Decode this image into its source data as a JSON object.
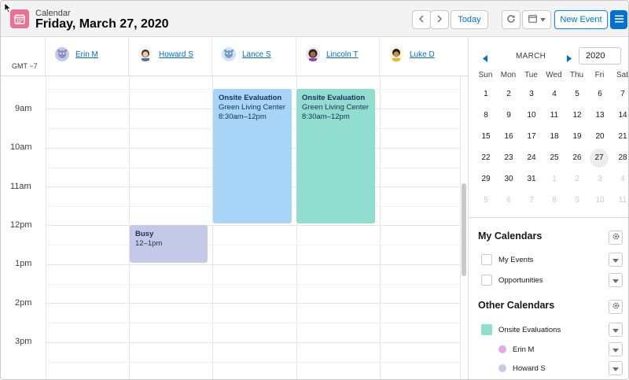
{
  "header": {
    "kicker": "Calendar",
    "title": "Friday, March 27, 2020",
    "today_label": "Today",
    "new_event_label": "New Event"
  },
  "grid": {
    "timezone": "GMT −7",
    "people": [
      {
        "name": "Erin M"
      },
      {
        "name": "Howard S"
      },
      {
        "name": "Lance S"
      },
      {
        "name": "Lincoln T"
      },
      {
        "name": "Luke D"
      }
    ],
    "hours": [
      "9am",
      "10am",
      "11am",
      "12pm",
      "1pm",
      "2pm",
      "3pm"
    ],
    "events": [
      {
        "title": "Onsite Evaluation",
        "location": "Green Living Center",
        "time": "8:30am–12pm",
        "color": "#a8d4f7"
      },
      {
        "title": "Onsite Evaluation",
        "location": "Green Living Center",
        "time": "8:30am–12pm",
        "color": "#91ddd0"
      },
      {
        "title": "Busy",
        "location": "",
        "time": "12–1pm",
        "color": "#c5c9e8"
      }
    ]
  },
  "mini_calendar": {
    "month": "MARCH",
    "year": "2020",
    "dow": [
      "Sun",
      "Mon",
      "Tue",
      "Wed",
      "Thu",
      "Fri",
      "Sat"
    ],
    "weeks": [
      [
        "1",
        "2",
        "3",
        "4",
        "5",
        "6",
        "7"
      ],
      [
        "8",
        "9",
        "10",
        "11",
        "12",
        "13",
        "14"
      ],
      [
        "15",
        "16",
        "17",
        "18",
        "19",
        "20",
        "21"
      ],
      [
        "22",
        "23",
        "24",
        "25",
        "26",
        "27",
        "28"
      ],
      [
        "29",
        "30",
        "31",
        "1",
        "2",
        "3",
        "4"
      ],
      [
        "5",
        "6",
        "7",
        "8",
        "9",
        "10",
        "11"
      ]
    ],
    "today": "27"
  },
  "my_calendars": {
    "title": "My Calendars",
    "items": [
      {
        "label": "My Events"
      },
      {
        "label": "Opportunities"
      }
    ]
  },
  "other_calendars": {
    "title": "Other Calendars",
    "items": [
      {
        "label": "Onsite Evaluations",
        "color": "#91ddd0"
      },
      {
        "label": "Erin M",
        "color": "#e3a8e6"
      },
      {
        "label": "Howard S",
        "color": "#c5c9e8"
      }
    ]
  },
  "colors": {
    "brand": "#0070d2",
    "calendar_icon": "#eb7092"
  }
}
